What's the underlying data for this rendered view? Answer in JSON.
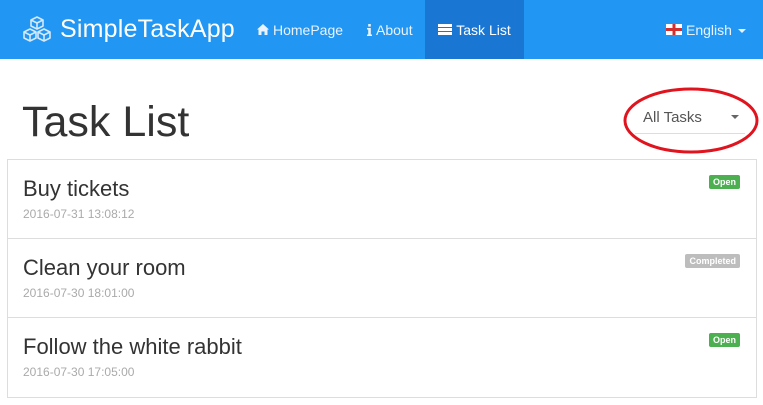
{
  "navbar": {
    "brand": "SimpleTaskApp",
    "brand_icon": "cubes-icon",
    "items": [
      {
        "label": "HomePage",
        "icon": "home-icon"
      },
      {
        "label": "About",
        "icon": "info-icon"
      },
      {
        "label": "Task List",
        "icon": "list-icon"
      }
    ],
    "language": {
      "label": "English",
      "icon": "england-flag-icon"
    },
    "colors": {
      "background": "#2196f3",
      "active": "#1976d2"
    }
  },
  "page": {
    "title": "Task List",
    "filter": {
      "selected": "All Tasks"
    }
  },
  "tasks": [
    {
      "title": "Buy tickets",
      "date": "2016-07-31 13:08:12",
      "status": "Open",
      "status_color": "#4caf50"
    },
    {
      "title": "Clean your room",
      "date": "2016-07-30 18:01:00",
      "status": "Completed",
      "status_color": "#bdbdbd"
    },
    {
      "title": "Follow the white rabbit",
      "date": "2016-07-30 17:05:00",
      "status": "Open",
      "status_color": "#4caf50"
    }
  ],
  "annotation_color": "#e0141e"
}
